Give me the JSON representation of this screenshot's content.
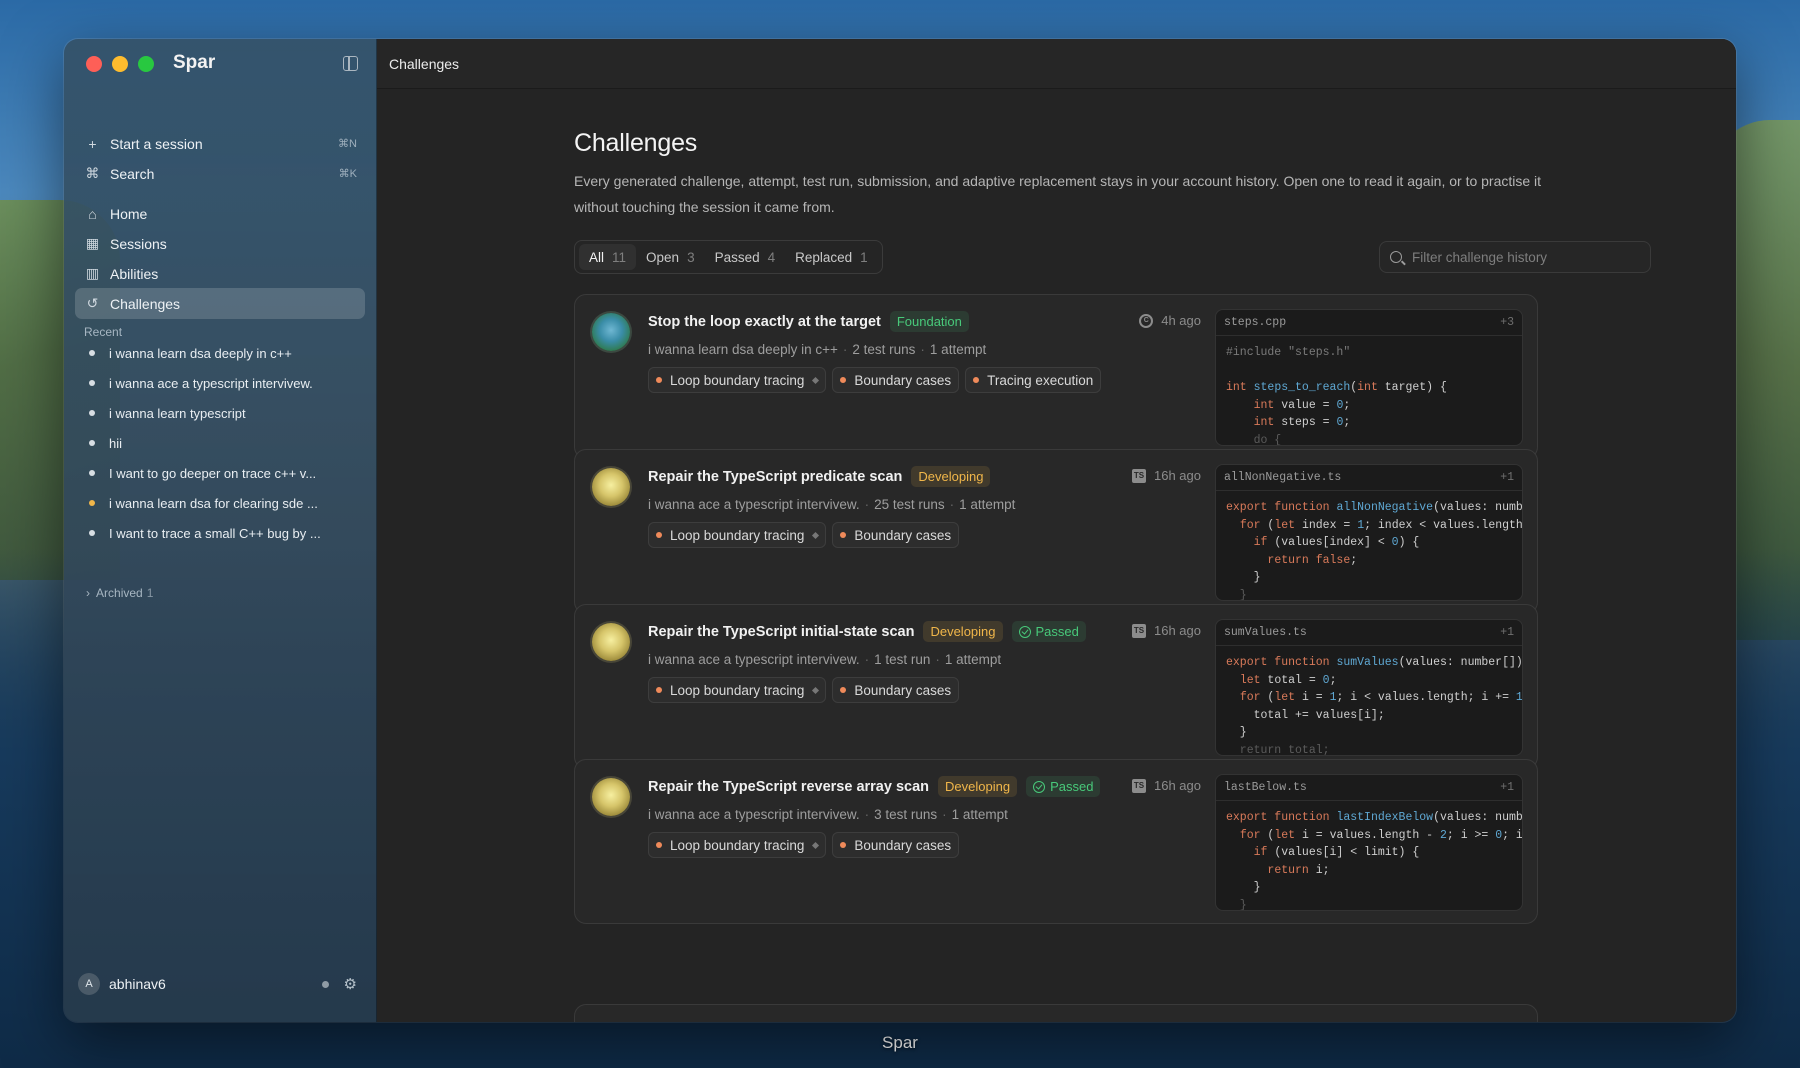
{
  "app": {
    "brand": "Spar",
    "dock_label": "Spar"
  },
  "sidebar": {
    "actions": [
      {
        "label": "Start a session",
        "kbd": "⌘N",
        "icon": "plus-icon"
      },
      {
        "label": "Search",
        "kbd": "⌘K",
        "icon": "command-icon"
      }
    ],
    "nav": [
      {
        "label": "Home",
        "icon": "home-icon"
      },
      {
        "label": "Sessions",
        "icon": "grid-icon"
      },
      {
        "label": "Abilities",
        "icon": "map-icon"
      },
      {
        "label": "Challenges",
        "icon": "history-icon",
        "active": true
      }
    ],
    "recent_label": "Recent",
    "recent": [
      {
        "label": "i wanna learn dsa deeply in c++"
      },
      {
        "label": "i wanna ace a typescript intervivew."
      },
      {
        "label": "i wanna learn typescript"
      },
      {
        "label": "hii"
      },
      {
        "label": "I want to go deeper on trace c++ v..."
      },
      {
        "label": "i wanna learn dsa for clearing sde ...",
        "status": "amber"
      },
      {
        "label": "I want to trace a small C++ bug by ..."
      }
    ],
    "archived": {
      "label": "Archived",
      "count": "1"
    },
    "user": {
      "initial": "A",
      "name": "abhinav6"
    }
  },
  "topbar": {
    "title": "Challenges"
  },
  "page": {
    "title": "Challenges",
    "description": "Every generated challenge, attempt, test run, submission, and adaptive replacement stays in your account history. Open one to read it again, or to practise it without touching the session it came from.",
    "tabs": [
      {
        "label": "All",
        "count": "11",
        "active": true
      },
      {
        "label": "Open",
        "count": "3"
      },
      {
        "label": "Passed",
        "count": "4"
      },
      {
        "label": "Replaced",
        "count": "1"
      }
    ],
    "search_placeholder": "Filter challenge history"
  },
  "colors": {
    "foundation": "#48c97a",
    "developing": "#f0b64a",
    "passed": "#48c97a",
    "chip_dot": "#ef8a5a"
  },
  "challenges": [
    {
      "title": "Stop the loop exactly at the target",
      "level": "Foundation",
      "passed": null,
      "lang": "C",
      "time": "4h ago",
      "session": "i wanna learn dsa deeply in c++",
      "test_runs": "2 test runs",
      "attempts": "1 attempt",
      "chips": [
        "Loop boundary tracing",
        "Boundary cases",
        "Tracing execution"
      ],
      "file": "steps.cpp",
      "file_extra": "+3",
      "orb": "teal"
    },
    {
      "title": "Repair the TypeScript predicate scan",
      "level": "Developing",
      "passed": null,
      "lang": "TS",
      "time": "16h ago",
      "session": "i wanna ace a typescript intervivew.",
      "test_runs": "25 test runs",
      "attempts": "1 attempt",
      "chips": [
        "Loop boundary tracing",
        "Boundary cases"
      ],
      "file": "allNonNegative.ts",
      "file_extra": "+1",
      "orb": "gold"
    },
    {
      "title": "Repair the TypeScript initial-state scan",
      "level": "Developing",
      "passed": "Passed",
      "lang": "TS",
      "time": "16h ago",
      "session": "i wanna ace a typescript intervivew.",
      "test_runs": "1 test run",
      "attempts": "1 attempt",
      "chips": [
        "Loop boundary tracing",
        "Boundary cases"
      ],
      "file": "sumValues.ts",
      "file_extra": "+1",
      "orb": "gold"
    },
    {
      "title": "Repair the TypeScript reverse array scan",
      "level": "Developing",
      "passed": "Passed",
      "lang": "TS",
      "time": "16h ago",
      "session": "i wanna ace a typescript intervivew.",
      "test_runs": "3 test runs",
      "attempts": "1 attempt",
      "chips": [
        "Loop boundary tracing",
        "Boundary cases"
      ],
      "file": "lastBelow.ts",
      "file_extra": "+1",
      "orb": "gold"
    }
  ]
}
